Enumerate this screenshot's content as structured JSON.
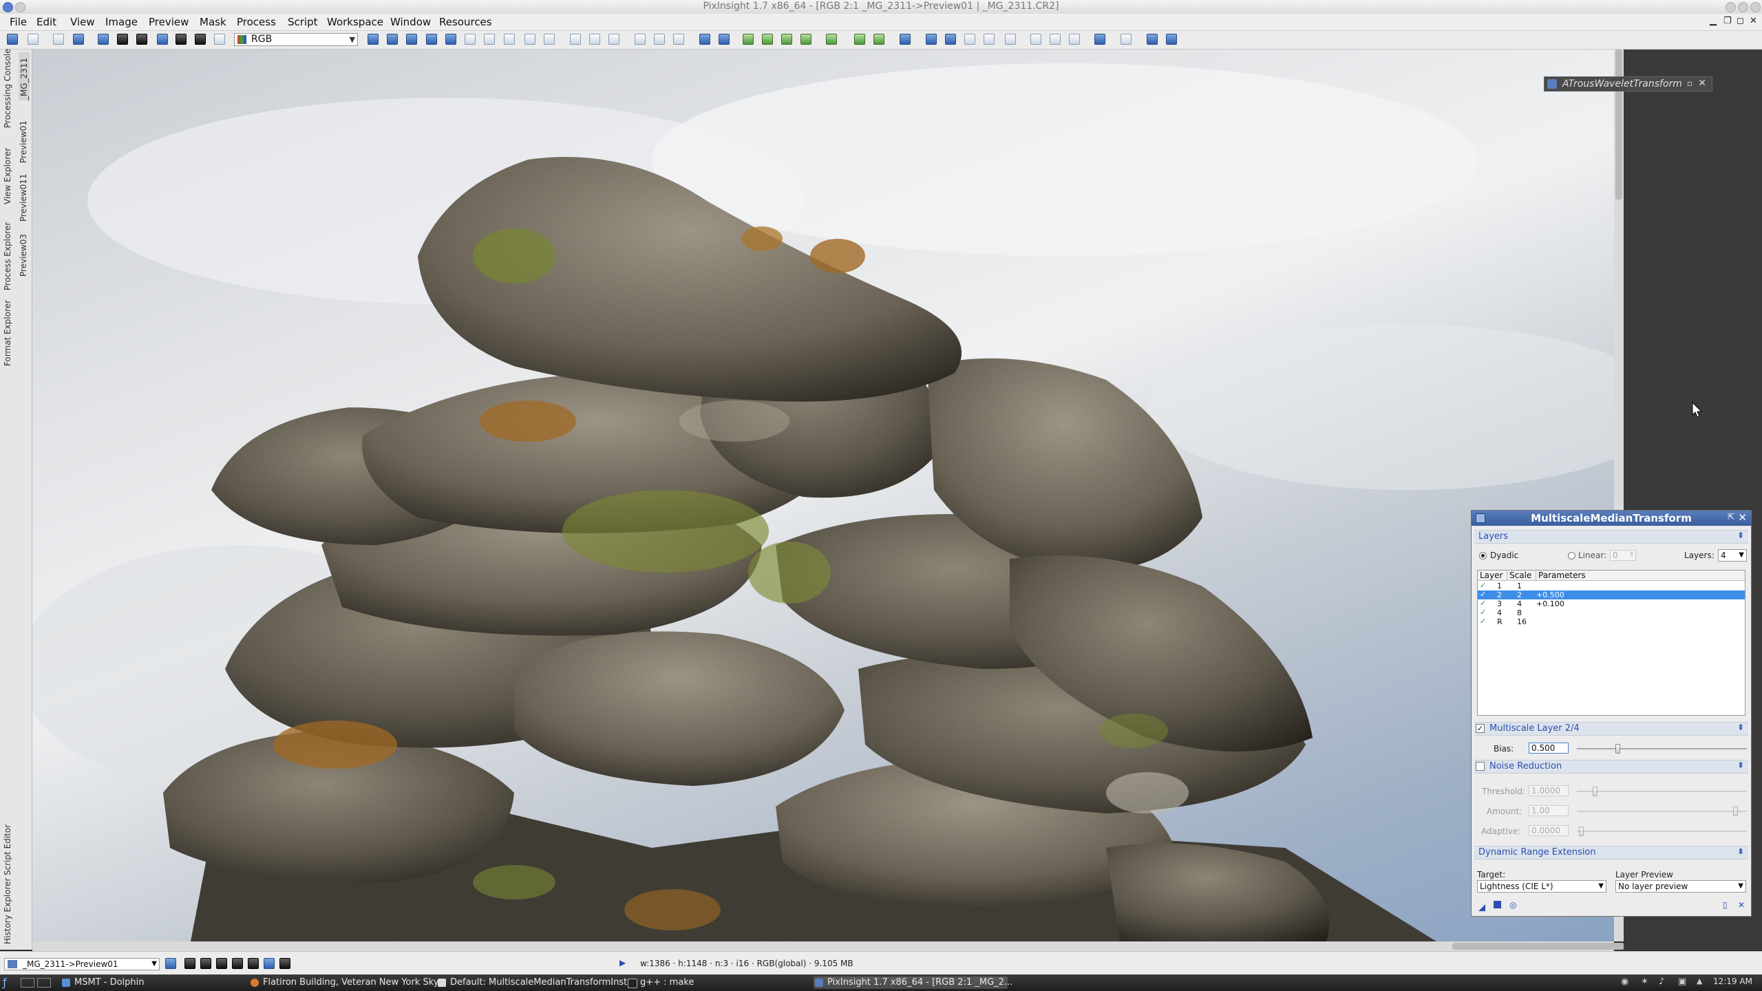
{
  "window": {
    "title": "PixInsight 1.7 x86_64 - [RGB 2:1 _MG_2311->Preview01 | _MG_2311.CR2]"
  },
  "menu": [
    "File",
    "Edit",
    "View",
    "Image",
    "Preview",
    "Mask",
    "Process",
    "Script",
    "Workspace",
    "Window",
    "Resources"
  ],
  "toolbar": {
    "channel_select": "RGB"
  },
  "left_dock": {
    "tabs": [
      "Processing Console",
      "View Explorer",
      "Process Explorer",
      "Format Explorer"
    ],
    "bottom_tabs": [
      "Script Editor",
      "History Explorer"
    ],
    "image_tabs": [
      "_MG_2311",
      "Preview01",
      "Preview011",
      "Preview03"
    ]
  },
  "atrous_window": {
    "title": "ATrousWaveletTransform"
  },
  "mmt": {
    "title": "MultiscaleMedianTransform",
    "layers_section": "Layers",
    "dyadic_label": "Dyadic",
    "linear_label": "Linear:",
    "linear_value": "0",
    "layers_label": "Layers:",
    "layers_value": "4",
    "table_headers": [
      "Layer",
      "Scale",
      "Parameters"
    ],
    "rows": [
      {
        "layer": "1",
        "scale": "1",
        "params": ""
      },
      {
        "layer": "2",
        "scale": "2",
        "params": "+0.500"
      },
      {
        "layer": "3",
        "scale": "4",
        "params": "+0.100"
      },
      {
        "layer": "4",
        "scale": "8",
        "params": ""
      },
      {
        "layer": "R",
        "scale": "16",
        "params": ""
      }
    ],
    "multiscale_layer_section": "Multiscale Layer 2/4",
    "bias_label": "Bias:",
    "bias_value": "0.500",
    "noise_reduction_section": "Noise Reduction",
    "threshold_label": "Threshold:",
    "threshold_value": "1.0000",
    "amount_label": "Amount:",
    "amount_value": "1.00",
    "adaptive_label": "Adaptive:",
    "adaptive_value": "0.0000",
    "dre_section": "Dynamic Range Extension",
    "target_label": "Target:",
    "target_value": "Lightness (CIE L*)",
    "layer_preview_label": "Layer Preview",
    "layer_preview_value": "No layer preview"
  },
  "statusbar": {
    "view_select": "_MG_2311->Preview01",
    "info": "w:1386 · h:1148 · n:3 · i16 · RGB(global) · 9.105 MB"
  },
  "taskbar": {
    "items": [
      "MSMT - Dolphin",
      "Flatiron Building, Veteran New York Sky...",
      "Default: MultiscaleMedianTransformInst...",
      "g++ : make",
      "PixInsight 1.7 x86_64 - [RGB 2:1 _MG_2..."
    ],
    "clock": "12:19 AM"
  },
  "colors": {
    "panel_header": "#3a5f9e",
    "section_text": "#2b4fb0",
    "selected_row": "#3d8ee8",
    "rock_moss": "#8a9a3a",
    "rock_lichen": "#b8782a"
  }
}
